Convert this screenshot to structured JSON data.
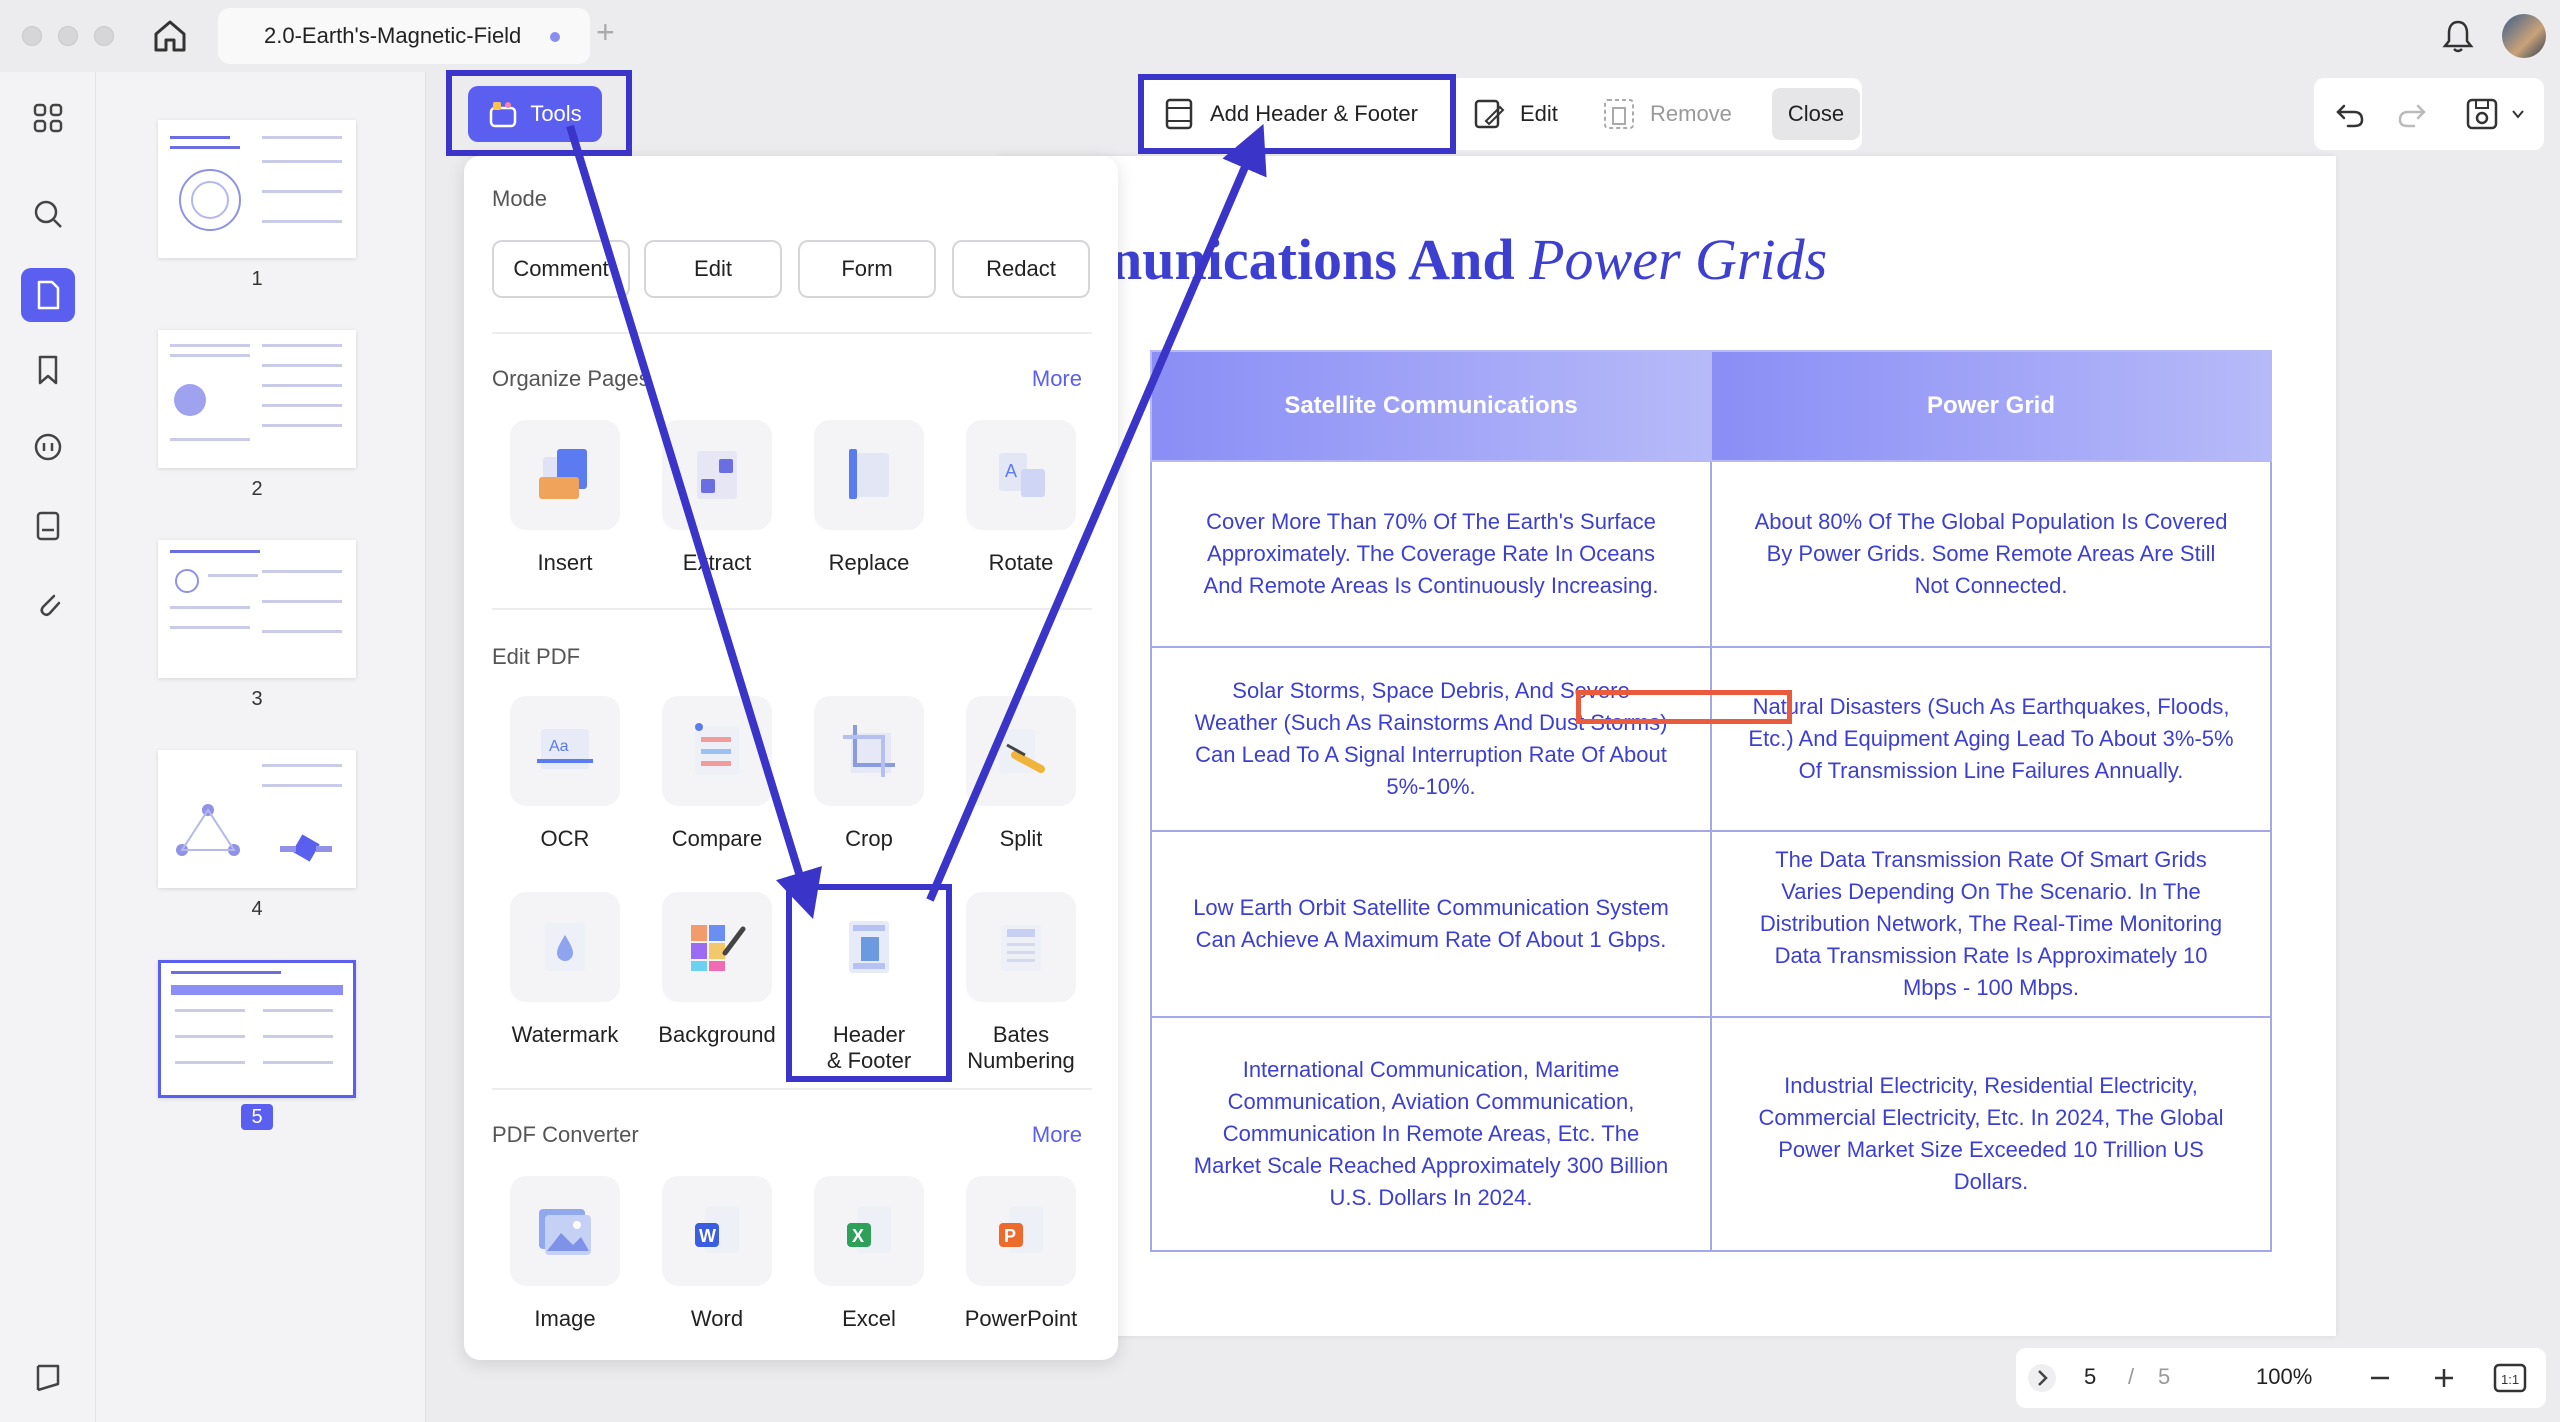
{
  "titlebar": {
    "tab_title": "2.0-Earth's-Magnetic-Field",
    "new_tab": "+"
  },
  "thumbnails": [
    {
      "label": "1"
    },
    {
      "label": "2"
    },
    {
      "label": "3"
    },
    {
      "label": "4"
    },
    {
      "label": "5",
      "selected": true
    }
  ],
  "toolbar": {
    "tools_label": "Tools",
    "add_header_footer": "Add Header & Footer",
    "edit": "Edit",
    "remove": "Remove",
    "close": "Close"
  },
  "panel": {
    "mode_title": "Mode",
    "modes": [
      "Comment",
      "Edit",
      "Form",
      "Redact"
    ],
    "organize_title": "Organize Pages",
    "more": "More",
    "organize": [
      "Insert",
      "Extract",
      "Replace",
      "Rotate"
    ],
    "edit_title": "Edit PDF",
    "edit_tools": [
      "OCR",
      "Compare",
      "Crop",
      "Split"
    ],
    "edit_tools2": [
      "Watermark",
      "Background",
      "Header\n& Footer",
      "Bates\nNumbering"
    ],
    "converter_title": "PDF Converter",
    "converter": [
      "Image",
      "Word",
      "Excel",
      "PowerPoint"
    ]
  },
  "document": {
    "title_bold": "nunications And",
    "title_italic": "Power Grids",
    "headers": [
      "Satellite Communications",
      "Power Grid"
    ],
    "rows": [
      [
        "Cover More Than 70% Of The Earth's Surface Approximately. The Coverage Rate In Oceans And Remote Areas Is Continuously Increasing.",
        "About 80% Of The Global Population Is Covered By Power Grids. Some Remote Areas Are Still Not Connected."
      ],
      [
        "Solar Storms, Space Debris, And Severe Weather (Such As Rainstorms And Dust Storms) Can Lead To A Signal Interruption Rate Of About 5%-10%.",
        "Natural Disasters (Such As Earthquakes, Floods, Etc.) And Equipment Aging Lead To About 3%-5% Of Transmission Line Failures Annually."
      ],
      [
        "Low Earth Orbit Satellite Communication System Can Achieve A Maximum Rate Of About 1 Gbps.",
        "The Data Transmission Rate Of Smart Grids Varies Depending On The Scenario. In The Distribution Network, The Real-Time Monitoring Data Transmission Rate Is Approximately 10 Mbps - 100 Mbps."
      ],
      [
        "International Communication, Maritime Communication, Aviation Communication, Communication In Remote Areas, Etc. The Market Scale Reached Approximately 300 Billion U.S. Dollars In 2024.",
        "Industrial Electricity, Residential Electricity, Commercial Electricity, Etc. In 2024, The Global Power Market Size Exceeded 10 Trillion US Dollars."
      ]
    ]
  },
  "pagination": {
    "current": "5",
    "separator": "/",
    "total": "5",
    "zoom": "100%"
  },
  "colors": {
    "accent": "#5b5ff0",
    "annotation": "#3a35c8",
    "highlight_red": "#ea5a3c"
  }
}
